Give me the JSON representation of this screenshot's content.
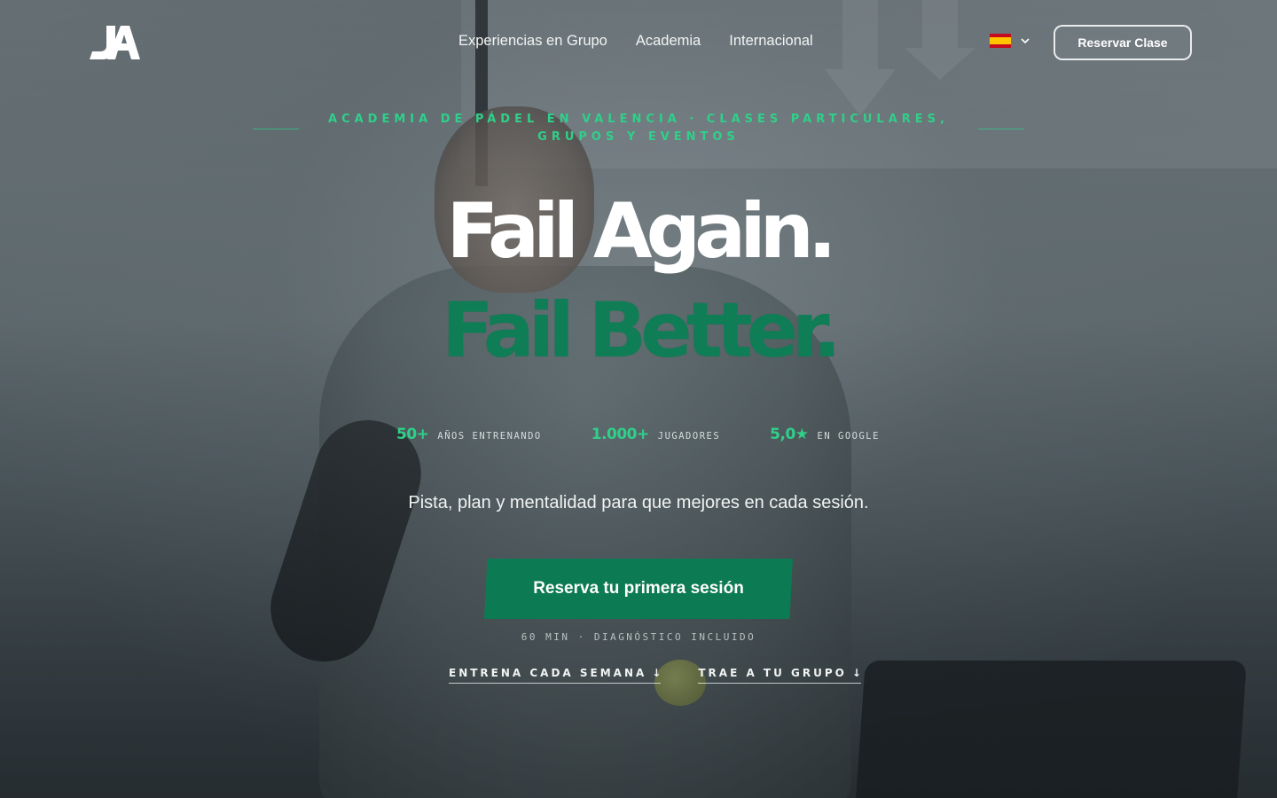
{
  "logo": {
    "label": "JA"
  },
  "nav": {
    "items": [
      {
        "label": "Experiencias en Grupo"
      },
      {
        "label": "Academia"
      },
      {
        "label": "Internacional"
      }
    ],
    "cta_label": "Reservar Clase"
  },
  "language": {
    "icon": "spain-flag-icon",
    "dropdown_icon": "chevron-down-icon"
  },
  "hero": {
    "eyebrow": "ACADEMIA DE PÁDEL EN VALENCIA · CLASES PARTICULARES, GRUPOS Y EVENTOS",
    "headline_line1": "Fail Again.",
    "headline_line2": "Fail Better.",
    "stats": [
      {
        "value": "50+",
        "label": "AÑOS ENTRENANDO"
      },
      {
        "value": "1.000+",
        "label": "JUGADORES"
      },
      {
        "value": "5,0★",
        "label": "EN GOOGLE"
      }
    ],
    "subtitle": "Pista, plan y mentalidad para que mejores en cada sesión.",
    "cta_label": "Reserva tu primera sesión",
    "cta_note": "60 MIN · DIAGNÓSTICO INCLUIDO",
    "links": [
      {
        "label": "ENTRENA CADA SEMANA",
        "icon": "arrow-down-icon",
        "glyph": "↓"
      },
      {
        "label": "TRAE A TU GRUPO",
        "icon": "arrow-down-icon",
        "glyph": "↓"
      }
    ]
  },
  "colors": {
    "accent_green": "#2fd08a",
    "brand_green": "#0c7a52",
    "headline_green": "#0f7d55"
  }
}
